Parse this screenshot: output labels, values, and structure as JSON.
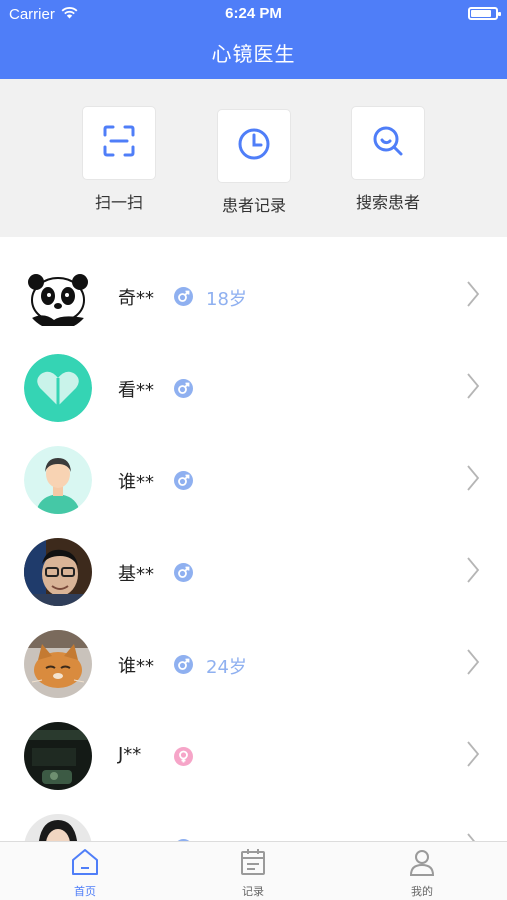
{
  "status_bar": {
    "carrier": "Carrier",
    "time": "6:24 PM",
    "battery_level": 0.85
  },
  "nav": {
    "title": "心镜医生"
  },
  "actions": [
    {
      "label": "扫一扫",
      "icon": "scan-icon"
    },
    {
      "label": "患者记录",
      "icon": "clock-icon"
    },
    {
      "label": "搜索患者",
      "icon": "search-icon"
    }
  ],
  "patients": [
    {
      "name": "奇**",
      "gender": "male",
      "age": "18岁",
      "avatar": "panda-avatar"
    },
    {
      "name": "看**",
      "gender": "male",
      "age": "",
      "avatar": "heart-avatar"
    },
    {
      "name": "谁**",
      "gender": "male",
      "age": "",
      "avatar": "person-avatar"
    },
    {
      "name": "基**",
      "gender": "male",
      "age": "",
      "avatar": "photo-avatar"
    },
    {
      "name": "谁**",
      "gender": "male",
      "age": "24岁",
      "avatar": "cat-avatar"
    },
    {
      "name": "J**",
      "gender": "female",
      "age": "",
      "avatar": "dark-photo-avatar"
    },
    {
      "name": "",
      "gender": "male",
      "age": "",
      "avatar": "girl-photo-avatar"
    }
  ],
  "tabs": [
    {
      "label": "首页",
      "icon": "home-icon",
      "active": true
    },
    {
      "label": "记录",
      "icon": "record-icon",
      "active": false
    },
    {
      "label": "我的",
      "icon": "user-icon",
      "active": false
    }
  ],
  "colors": {
    "primary": "#4f7ef8",
    "male": "#8fb0f0",
    "female": "#f6a5c8",
    "background": "#f1f1f1"
  }
}
